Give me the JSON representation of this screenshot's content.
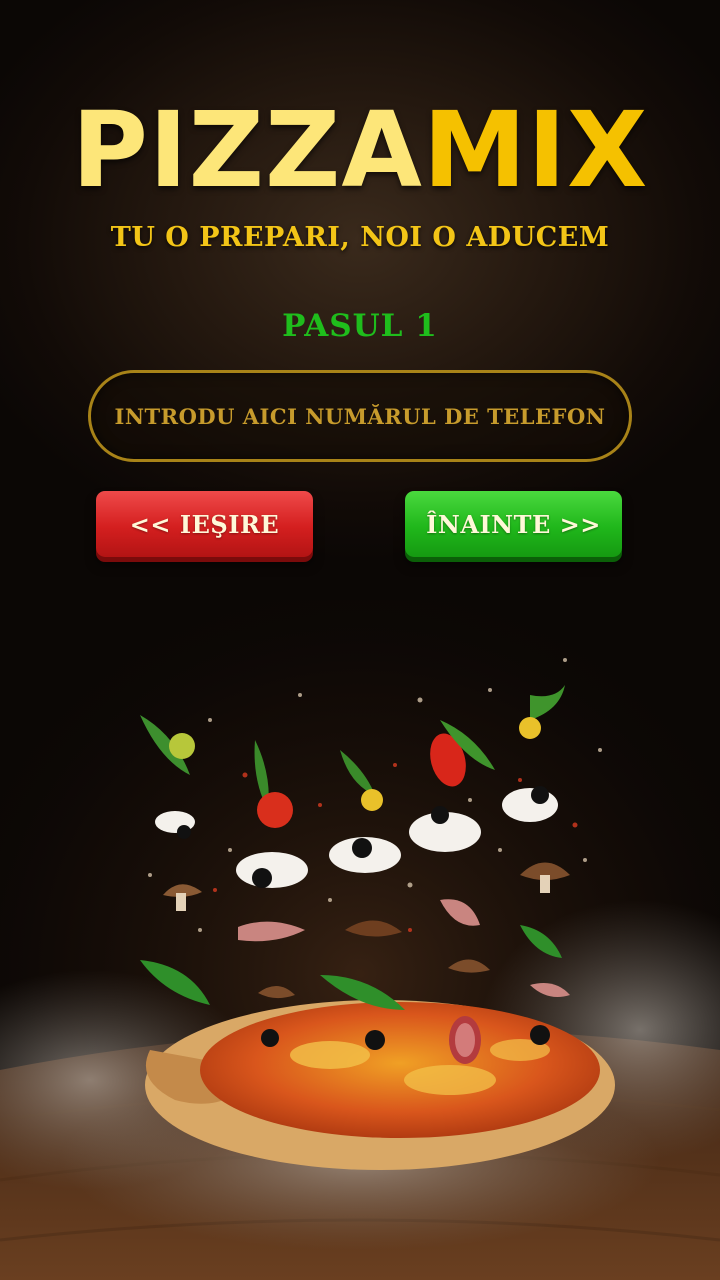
{
  "header": {
    "logo_part1": "PIZZA",
    "logo_part2": "MIX",
    "tagline": "TU O PREPARI, NOI O ADUCEM"
  },
  "form": {
    "step_label": "PASUL 1",
    "phone_placeholder": "INTRODU AICI NUMĂRUL DE TELEFON",
    "phone_value": ""
  },
  "buttons": {
    "exit_label": "<< IEŞIRE",
    "next_label": "ÎNAINTE >>"
  },
  "colors": {
    "logo_light": "#fde679",
    "logo_accent": "#f5c100",
    "step_green": "#1fbd1c",
    "exit_red": "#d41f1f",
    "next_green": "#20b71b",
    "input_border_gold": "#a88318"
  },
  "hero": {
    "image": "flying-pizza-with-toppings"
  }
}
